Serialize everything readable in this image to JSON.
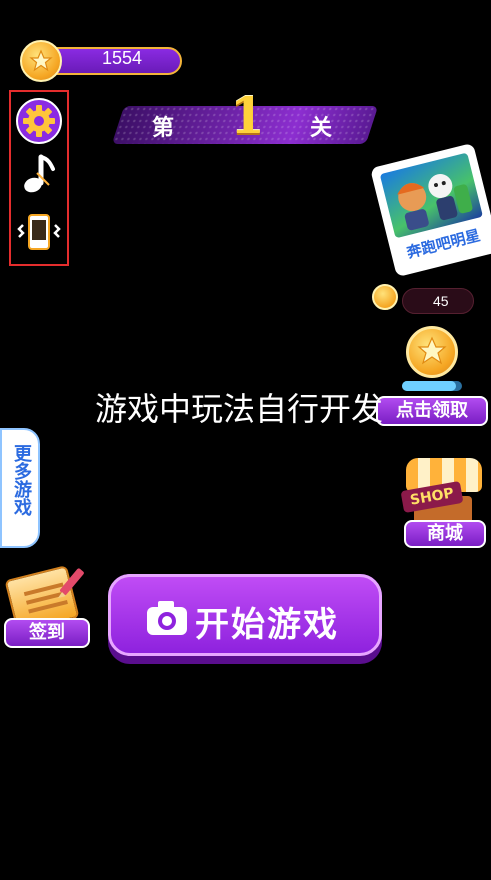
{
  "hud": {
    "coins": "1554"
  },
  "settings_panel": {
    "icons": [
      "gear-icon",
      "music-note-icon",
      "vibration-icon"
    ]
  },
  "level": {
    "prefix": "第",
    "number": "1",
    "suffix": "关"
  },
  "promo": {
    "title": "奔跑吧明星"
  },
  "reward": {
    "count": "45",
    "button_label": "点击领取",
    "progress": 0.9
  },
  "hint": "游戏中玩法自行开发",
  "more_games": {
    "label": "更多游戏"
  },
  "shop": {
    "sign": "SHOP",
    "label": "商城"
  },
  "checkin": {
    "label": "签到"
  },
  "start": {
    "label": "开始游戏"
  },
  "colors": {
    "accent": "#8e22de",
    "gold": "#f5a623",
    "highlight_border": "#e52d2d"
  }
}
